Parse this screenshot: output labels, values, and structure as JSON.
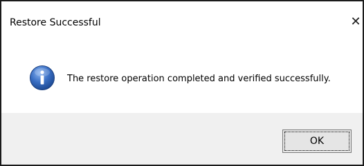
{
  "window": {
    "title": "Restore Successful",
    "close_glyph": "✕"
  },
  "message": {
    "icon": "info-icon",
    "text": "The restore operation completed and verified successfully."
  },
  "buttons": {
    "ok_label": "OK"
  },
  "colors": {
    "info_icon": "#3a6fc4",
    "footer_bg": "#f0f0f0"
  }
}
